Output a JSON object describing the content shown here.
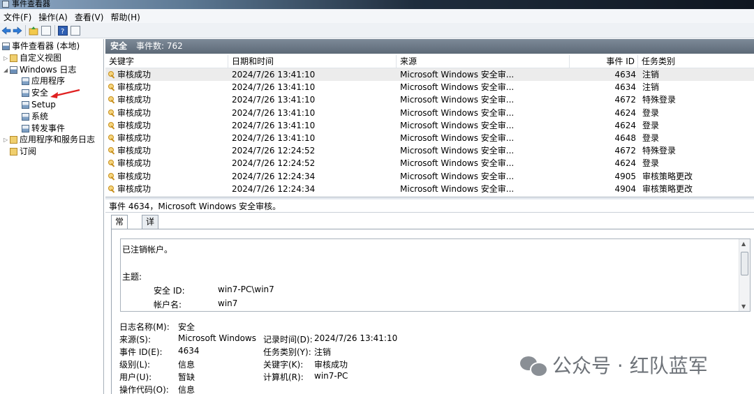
{
  "window": {
    "title": "事件查看器"
  },
  "menu": [
    "文件(F)",
    "操作(A)",
    "查看(V)",
    "帮助(H)"
  ],
  "toolbar": {
    "icons": [
      "back-arrow-icon",
      "forward-arrow-icon",
      "folder-up-icon",
      "pane-icon",
      "help-icon",
      "pane-icon"
    ]
  },
  "tree": {
    "root": "事件查看器 (本地)",
    "items": [
      {
        "label": "自定义视图",
        "level": 1,
        "expander": "▷"
      },
      {
        "label": "Windows 日志",
        "level": 1,
        "expander": "◢"
      },
      {
        "label": "应用程序",
        "level": 2
      },
      {
        "label": "安全",
        "level": 2
      },
      {
        "label": "Setup",
        "level": 2
      },
      {
        "label": "系统",
        "level": 2
      },
      {
        "label": "转发事件",
        "level": 2
      },
      {
        "label": "应用程序和服务日志",
        "level": 1,
        "expander": "▷"
      },
      {
        "label": "订阅",
        "level": 1
      }
    ]
  },
  "main": {
    "log_name": "安全",
    "event_count": "事件数: 762"
  },
  "table": {
    "columns": [
      "关键字",
      "日期和时间",
      "来源",
      "事件 ID",
      "任务类别"
    ],
    "rows": [
      {
        "keyword": "审核成功",
        "datetime": "2024/7/26 13:41:10",
        "source": "Microsoft Windows 安全审...",
        "id": "4634",
        "category": "注销"
      },
      {
        "keyword": "审核成功",
        "datetime": "2024/7/26 13:41:10",
        "source": "Microsoft Windows 安全审...",
        "id": "4634",
        "category": "注销"
      },
      {
        "keyword": "审核成功",
        "datetime": "2024/7/26 13:41:10",
        "source": "Microsoft Windows 安全审...",
        "id": "4672",
        "category": "特殊登录"
      },
      {
        "keyword": "审核成功",
        "datetime": "2024/7/26 13:41:10",
        "source": "Microsoft Windows 安全审...",
        "id": "4624",
        "category": "登录"
      },
      {
        "keyword": "审核成功",
        "datetime": "2024/7/26 13:41:10",
        "source": "Microsoft Windows 安全审...",
        "id": "4624",
        "category": "登录"
      },
      {
        "keyword": "审核成功",
        "datetime": "2024/7/26 13:41:10",
        "source": "Microsoft Windows 安全审...",
        "id": "4648",
        "category": "登录"
      },
      {
        "keyword": "审核成功",
        "datetime": "2024/7/26 12:24:52",
        "source": "Microsoft Windows 安全审...",
        "id": "4672",
        "category": "特殊登录"
      },
      {
        "keyword": "审核成功",
        "datetime": "2024/7/26 12:24:52",
        "source": "Microsoft Windows 安全审...",
        "id": "4624",
        "category": "登录"
      },
      {
        "keyword": "审核成功",
        "datetime": "2024/7/26 12:24:34",
        "source": "Microsoft Windows 安全审...",
        "id": "4905",
        "category": "审核策略更改"
      },
      {
        "keyword": "审核成功",
        "datetime": "2024/7/26 12:24:34",
        "source": "Microsoft Windows 安全审...",
        "id": "4904",
        "category": "审核策略更改"
      }
    ]
  },
  "detail": {
    "title": "事件 4634，Microsoft Windows 安全审核。",
    "tabs": [
      "常规",
      "详细信息"
    ],
    "message": {
      "line1": "已注销帐户。",
      "subject": "主题:",
      "sid_label": "安全 ID:",
      "sid_value": "win7-PC\\win7",
      "account_label": "帐户名:",
      "account_value": "win7"
    },
    "props": {
      "log_name_label": "日志名称(M):",
      "log_name": "安全",
      "source_label": "来源(S):",
      "source": "Microsoft Windows !",
      "logged_label": "记录时间(D):",
      "logged": "2024/7/26 13:41:10",
      "event_id_label": "事件 ID(E):",
      "event_id": "4634",
      "task_label": "任务类别(Y):",
      "task": "注销",
      "level_label": "级别(L):",
      "level": "信息",
      "keywords_label": "关键字(K):",
      "keywords": "审核成功",
      "user_label": "用户(U):",
      "user": "暂缺",
      "computer_label": "计算机(R):",
      "computer": "win7-PC",
      "opcode_label": "操作代码(O):",
      "opcode": "信息"
    }
  },
  "watermark": "公众号 · 红队蓝军",
  "colors": {
    "header_bar": "#6b7785",
    "selected_row": "#ececec",
    "annotation_arrow": "#e02020"
  }
}
